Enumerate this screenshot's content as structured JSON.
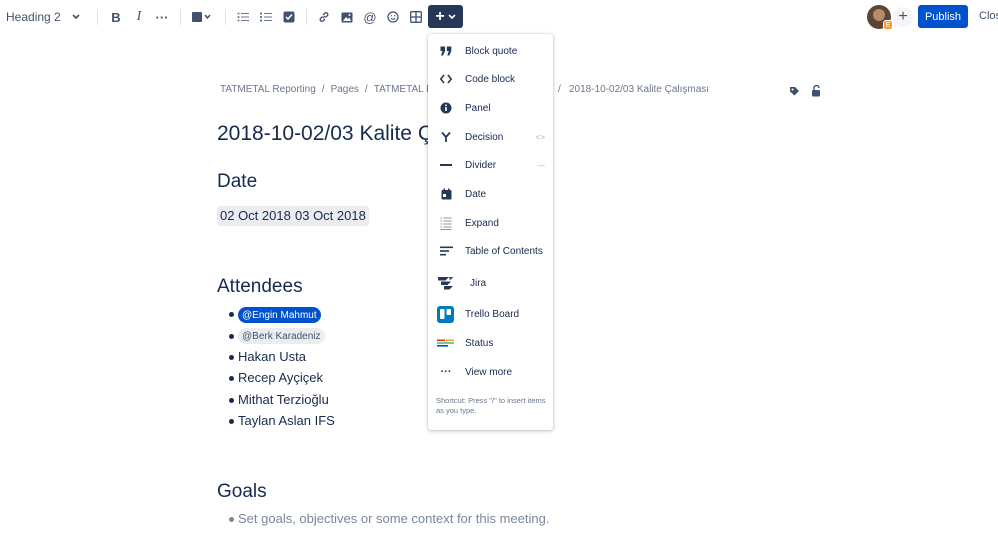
{
  "toolbar": {
    "heading_label": "Heading 2",
    "publish_label": "Publish",
    "close_label": "Close",
    "avatar_badge": "E",
    "icons": [
      "bold-icon",
      "italic-icon",
      "more-formatting-icon",
      "text-color-icon",
      "bullet-list-icon",
      "numbered-list-icon",
      "action-item-icon",
      "link-icon",
      "image-icon",
      "mention-icon",
      "emoji-icon",
      "table-icon",
      "insert-plus-icon"
    ]
  },
  "breadcrumb": {
    "space": "TATMETAL Reporting",
    "pages": "Pages",
    "parent": "TATMETAL R",
    "current": "2018-10-02/03 Kalite Çalışması",
    "separator": "/"
  },
  "page": {
    "title": "2018-10-02/03 Kalite Ça",
    "date_heading": "Date",
    "dates": [
      "02 Oct 2018",
      "03 Oct 2018"
    ],
    "attendees_heading": "Attendees",
    "mentions": [
      "@Engin Mahmut",
      "@Berk Karadeniz"
    ],
    "attendees": [
      "Hakan Usta",
      "Recep Ayçiçek",
      "Mithat Terzioğlu",
      "Taylan Aslan IFS"
    ],
    "goals_heading": "Goals",
    "goals_placeholder": "Set goals, objectives or some context for this meeting."
  },
  "insert_menu": {
    "items": [
      {
        "label": "Block quote",
        "icon": "quote-icon",
        "shortcut": ""
      },
      {
        "label": "Code block",
        "icon": "code-icon",
        "shortcut": ""
      },
      {
        "label": "Panel",
        "icon": "info-icon",
        "shortcut": ""
      },
      {
        "label": "Decision",
        "icon": "decision-icon",
        "shortcut": "<>"
      },
      {
        "label": "Divider",
        "icon": "divider-icon",
        "shortcut": "---"
      },
      {
        "label": "Date",
        "icon": "calendar-icon",
        "shortcut": ""
      },
      {
        "label": "Expand",
        "icon": "expand-icon",
        "shortcut": ""
      },
      {
        "label": "Table of Contents",
        "icon": "toc-icon",
        "shortcut": ""
      },
      {
        "label": "Jira",
        "icon": "jira-icon",
        "shortcut": ""
      },
      {
        "label": "Trello Board",
        "icon": "trello-icon",
        "shortcut": ""
      },
      {
        "label": "Status",
        "icon": "status-icon",
        "shortcut": ""
      },
      {
        "label": "View more",
        "icon": "more-icon",
        "shortcut": ""
      }
    ],
    "hint": "Shortcut: Press \"/\" to insert items as you type."
  },
  "colors": {
    "primary": "#0052cc",
    "insert_button": "#253858",
    "text": "#172b4d",
    "subtle": "#6b778c"
  }
}
